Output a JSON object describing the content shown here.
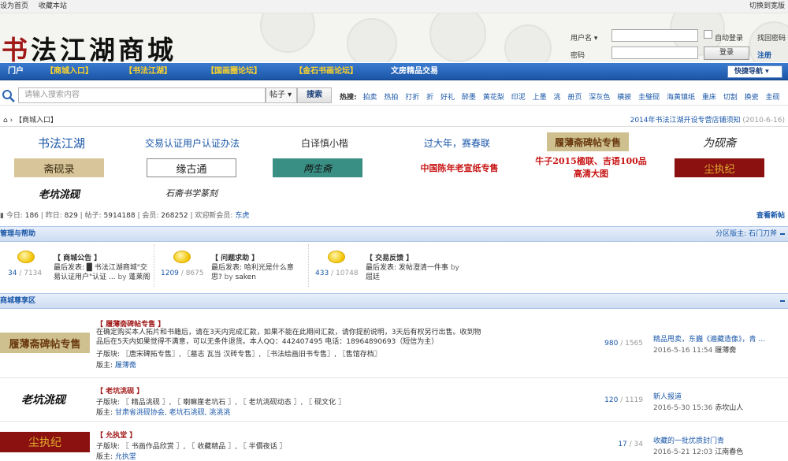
{
  "topbar": {
    "set_home": "设为首页",
    "bookmark": "收藏本站",
    "wide_switch": "切换到宽版"
  },
  "header": {
    "logo_text": "书法江湖商城",
    "logo_first": "书",
    "logo_rest": "法江湖商城"
  },
  "login": {
    "username_label": "用户名",
    "password_label": "密码",
    "remember": "自动登录",
    "forgot": "找回密码",
    "login_button": "登录",
    "register": "注册"
  },
  "nav": {
    "items": [
      {
        "label": "门户"
      },
      {
        "label": "【商城入口】"
      },
      {
        "label": "【书法江湖】"
      },
      {
        "label": "【国画圈论坛】"
      },
      {
        "label": "【金石书画论坛】"
      },
      {
        "label": "文房精品交易"
      }
    ],
    "quick_nav": "快捷导航"
  },
  "search": {
    "placeholder": "请输入搜索内容",
    "scope": "帖子",
    "button": "搜索",
    "hot_label": "热搜:",
    "hot_words": [
      "拍卖",
      "热拍",
      "打折",
      "折",
      "好礼",
      "醉墨",
      "黄花梨",
      "印泥",
      "上墨",
      "洮",
      "册页",
      "深灰色",
      "横披",
      "圭璧砚",
      "海黄镇纸",
      "重床",
      "切割",
      "换瓷",
      "圭砚"
    ]
  },
  "breadcrumb": {
    "current": "【商城入口】",
    "notice_title": "2014年书法江湖开设专营店铺须知",
    "notice_date": "(2010-6-16)"
  },
  "ads": {
    "row1": [
      "书法江湖",
      "交易认证用户认证办法",
      "白译慎小楷",
      "过大年，赛春联",
      "履薄斋碑帖专售",
      "为砚斋"
    ],
    "row2": [
      "斋砚录",
      "缘古通",
      "两生斋",
      "中国陈年老宣纸专售",
      "牛子2015楹联、吉语100品",
      "尘执纪"
    ],
    "row2_extra": "高清大图",
    "row3": [
      "老坑洮砚",
      "石斋书学篆刻"
    ]
  },
  "stats": {
    "today_label": "今日:",
    "today": "186",
    "yesterday_label": "昨日:",
    "yesterday": "829",
    "posts_label": "帖子:",
    "posts": "5914188",
    "members_label": "会员:",
    "members": "268252",
    "welcome_label": "欢迎新会员:",
    "newest": "东虎",
    "view_new": "查看新帖"
  },
  "section1": {
    "title": "管理与帮助",
    "moderator_label": "分区版主:",
    "moderator": "石门刀斧",
    "forums": [
      {
        "count": "34",
        "total": "7134",
        "name": "【 商城公告 】",
        "last_label": "最后发表:",
        "last_title": "█ 书法江湖商城\"交易认证用户\"认证 ...",
        "by": "by",
        "user": "蓬莱阁"
      },
      {
        "count": "1209",
        "total": "8675",
        "name": "【 问题求助 】",
        "last_label": "最后发表:",
        "last_title": "哈利光是什么意思?",
        "by": "by",
        "user": "saken"
      },
      {
        "count": "433",
        "total": "10748",
        "name": "【 交易反馈 】",
        "last_label": "最后发表:",
        "last_title": "发帖澄清一件事",
        "by": "by",
        "user": "屈廷"
      }
    ]
  },
  "section2": {
    "title": "商城尊享区",
    "forums": [
      {
        "image_text": "履薄斋碑帖专售",
        "name": "【 履薄斋碑帖专售 】",
        "desc": "在确定购买本人拓片和书籍后，请在3天内完成汇款，如果不能在此期间汇款，请你提前说明，3天后有权另行出售。收到物品后在5天内如果觉得不满意，可以无条件退货。本人QQ：442407495  电话：18964890693（短信为主）",
        "subforums": "子版块: 〖唐宋碑拓专售〗, 〖墓志 瓦当 汉砖专售〗, 〖书法绘画旧书专售〗, 〖售馆存档〗",
        "mod_label": "版主:",
        "mod": "履薄斋",
        "count": "980",
        "total": "1565",
        "last_title": "精品甩卖，东巍《遍藏造像》，青 ...",
        "last_time": "2016-5-16 11:54",
        "last_user": "履薄斋"
      },
      {
        "image_text": "老坑洮砚",
        "name": "【 老坑洮砚 】",
        "subforums": "子版块: 〖 精品洮砚 〗, 〖 喇嘛崖老坑石 〗, 〖 老坑洮砚动态 〗, 〖 砚文化 〗",
        "mod_label": "版主:",
        "mod": "甘肃省洮砚协会, 老坑石洮砚, 洮洮洮",
        "count": "120",
        "total": "1119",
        "last_title": "新人报道",
        "last_time": "2016-5-30 15:36",
        "last_user": "赤坎山人"
      },
      {
        "image_text": "尘执纪",
        "name": "【 允执堂 】",
        "subforums": "子版块: 〖 书画作品欣赏 〗, 〖 收藏精品 〗, 〖 半價夜话 〗",
        "mod_label": "版主:",
        "mod": "允执堂",
        "count": "17",
        "total": "34",
        "last_title": "收藏的一批优质封门青",
        "last_time": "2016-5-21 12:03",
        "last_user": "江南春色"
      }
    ]
  },
  "colors": {
    "nav_blue": "#1b55a6",
    "accent_yellow": "#ffd52a",
    "link_blue": "#1a57a8",
    "forum_red": "#a01818",
    "ad_teal": "#3a8f84",
    "ad_red": "#8b1010"
  }
}
